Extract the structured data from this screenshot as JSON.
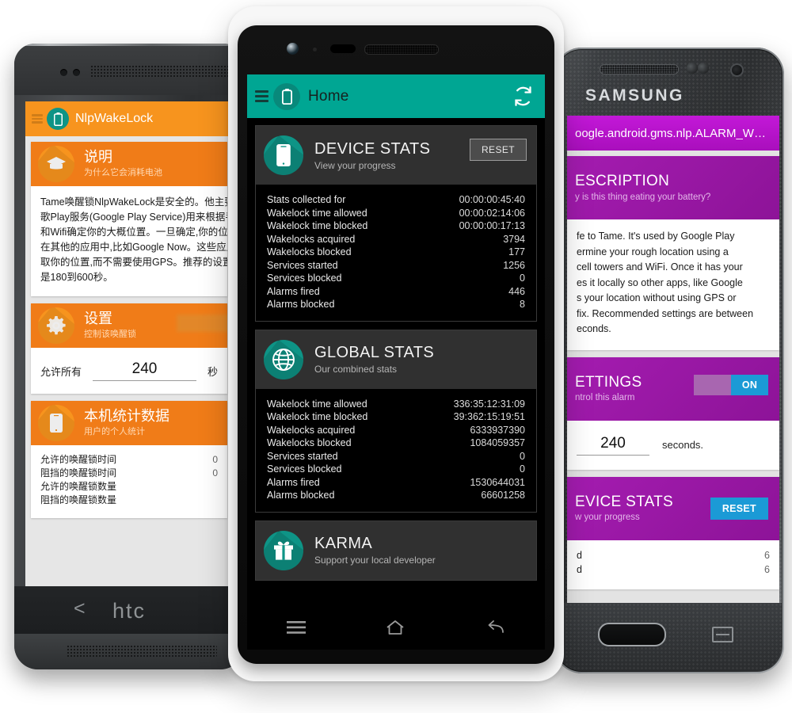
{
  "center_phone": {
    "device": "nexus-white",
    "appbar": {
      "title": "Home",
      "menu_icon": "hamburger-icon",
      "logo_icon": "battery-icon",
      "refresh_icon": "refresh-icon"
    },
    "cards": [
      {
        "id": "device-stats",
        "icon": "phone-icon",
        "title": "DEVICE STATS",
        "subtitle": "View your progress",
        "action_label": "RESET",
        "rows": [
          {
            "label": "Stats collected for",
            "value": "00:00:00:45:40"
          },
          {
            "label": "Wakelock time allowed",
            "value": "00:00:02:14:06"
          },
          {
            "label": "Wakelock time blocked",
            "value": "00:00:00:17:13"
          },
          {
            "label": "Wakelocks acquired",
            "value": "3794"
          },
          {
            "label": "Wakelocks blocked",
            "value": "177"
          },
          {
            "label": "Services started",
            "value": "1256"
          },
          {
            "label": "Services blocked",
            "value": "0"
          },
          {
            "label": "Alarms fired",
            "value": "446"
          },
          {
            "label": "Alarms blocked",
            "value": "8"
          }
        ]
      },
      {
        "id": "global-stats",
        "icon": "globe-icon",
        "title": "GLOBAL STATS",
        "subtitle": "Our combined stats",
        "rows": [
          {
            "label": "Wakelock time allowed",
            "value": "336:35:12:31:09"
          },
          {
            "label": "Wakelock time blocked",
            "value": "39:362:15:19:51"
          },
          {
            "label": "Wakelocks acquired",
            "value": "6333937390"
          },
          {
            "label": "Wakelocks blocked",
            "value": "1084059357"
          },
          {
            "label": "Services started",
            "value": "0"
          },
          {
            "label": "Services blocked",
            "value": "0"
          },
          {
            "label": "Alarms fired",
            "value": "1530644031"
          },
          {
            "label": "Alarms blocked",
            "value": "66601258"
          }
        ]
      },
      {
        "id": "karma",
        "icon": "gift-icon",
        "title": "KARMA",
        "subtitle": "Support your local developer"
      }
    ],
    "navbar": {
      "menu_icon": "menu-icon",
      "home_icon": "home-icon",
      "back_icon": "back-icon"
    },
    "colors": {
      "accent": "#00a693",
      "icon_circle": "#0e9486",
      "card_header": "#303030",
      "card_body": "#000000"
    }
  },
  "left_phone": {
    "device": "htc-one",
    "brand": "htc",
    "back_glyph": "<",
    "appbar": {
      "title": "NlpWakeLock",
      "menu_icon": "hamburger-icon",
      "logo_icon": "battery-icon"
    },
    "cards": [
      {
        "id": "description",
        "icon": "graduation-cap-icon",
        "title": "说明",
        "subtitle": "为什么它会消耗电池",
        "paragraph_lines": [
          "Tame唤醒锁NlpWakeLock是安全的。他主要被谷",
          "歌Play服务(Google Play Service)用来根据手机基站",
          "和Wifi确定你的大概位置。一旦确定,你的位置就保存",
          "在其他的应用中,比如Google Now。这些应用可以获",
          "取你的位置,而不需要使用GPS。推荐的设置值",
          "是180到600秒。"
        ]
      },
      {
        "id": "settings",
        "icon": "gear-icon",
        "title": "设置",
        "subtitle": "控制该唤醒锁",
        "toggle": "on",
        "input_label": "允许所有",
        "input_value": "240",
        "input_unit": "秒"
      },
      {
        "id": "device-stats",
        "icon": "phone-icon",
        "title": "本机统计数据",
        "subtitle": "用户的个人统计",
        "rows": [
          {
            "label": "允许的唤醒锁时间",
            "value": "0"
          },
          {
            "label": "阻挡的唤醒锁时间",
            "value": "0"
          },
          {
            "label": "允许的唤醒锁数量",
            "value": ""
          },
          {
            "label": "阻挡的唤醒锁数量",
            "value": ""
          }
        ]
      }
    ],
    "colors": {
      "accent": "#f7941e",
      "card_header": "#f07c18"
    }
  },
  "right_phone": {
    "device": "samsung-galaxy",
    "brand": "SAMSUNG",
    "appbar": {
      "title": "oogle.android.gms.nlp.ALARM_W…"
    },
    "cards": [
      {
        "id": "description",
        "title": "ESCRIPTION",
        "subtitle": "y is this thing eating your battery?",
        "paragraph_lines": [
          "fe to Tame. It's used by Google Play",
          "ermine your rough location using a",
          " cell towers and WiFi. Once it has your",
          "es it locally so other apps, like Google",
          "s your location without using GPS or",
          "fix. Recommended settings are between",
          "econds."
        ]
      },
      {
        "id": "settings",
        "title": "ETTINGS",
        "subtitle": "ntrol this alarm",
        "toggle_label": "ON",
        "input_value": "240",
        "input_unit": "seconds."
      },
      {
        "id": "device-stats",
        "title": "EVICE STATS",
        "subtitle": "w your progress",
        "action_label": "RESET",
        "rows": [
          {
            "label": "d",
            "value": "6"
          },
          {
            "label": "d",
            "value": "6"
          }
        ]
      }
    ],
    "colors": {
      "accent": "#b315c6",
      "button": "#1b9ad6"
    }
  }
}
